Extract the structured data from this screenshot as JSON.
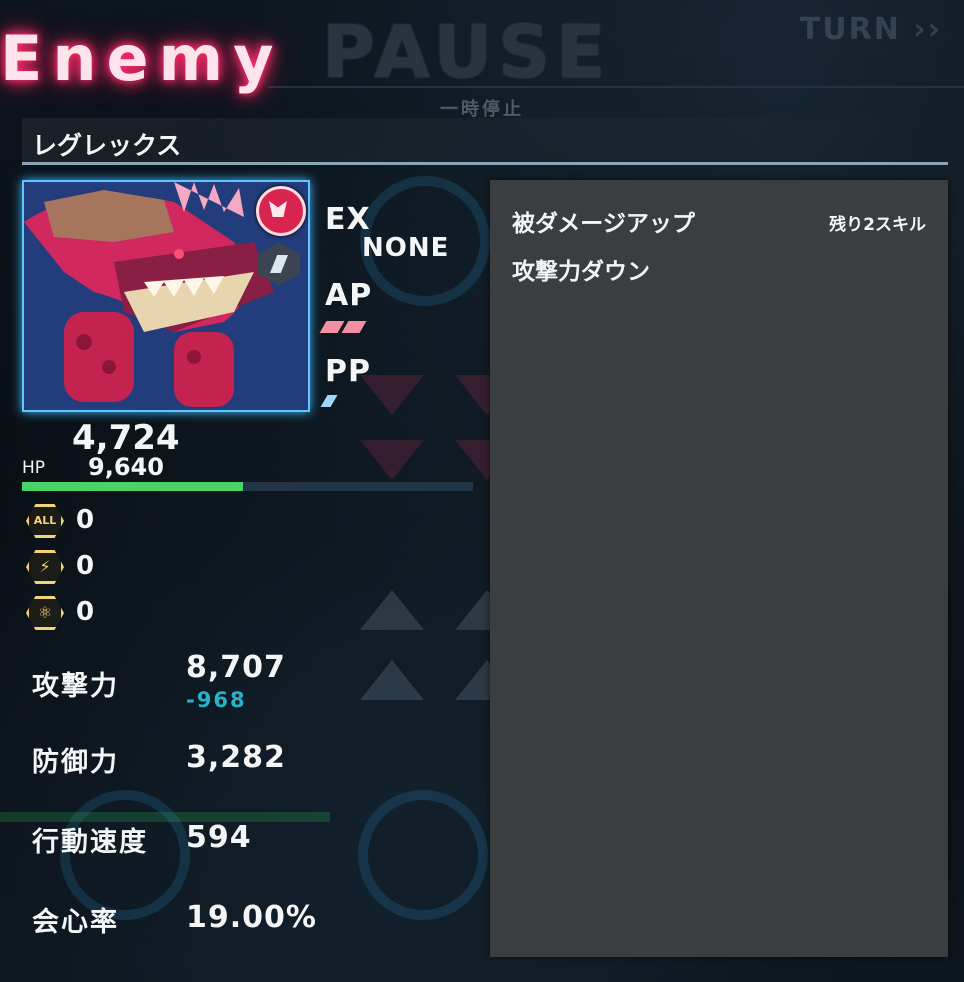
{
  "header": {
    "enemy_title": "Enemy",
    "pause_title": "PAUSE",
    "pause_sub": "一時停止",
    "turn_label": "TURN"
  },
  "enemy": {
    "name": "レグレックス",
    "ex_label": "EX",
    "ex_value": "NONE",
    "ap_label": "AP",
    "pp_label": "PP",
    "ap_pips": 2,
    "pp_pips": 1,
    "hp_current": "4,724",
    "hp_label": "HP",
    "hp_max": "9,640",
    "hp_fraction": 0.49,
    "resist": [
      {
        "icon": "all-resist-icon",
        "text": "ALL",
        "value": "0"
      },
      {
        "icon": "lightning-resist-icon",
        "text": "⚡",
        "value": "0"
      },
      {
        "icon": "atom-resist-icon",
        "text": "⚛",
        "value": "0"
      }
    ],
    "stats": {
      "attack_label": "攻撃力",
      "attack_value": "8,707",
      "attack_delta": "-968",
      "defense_label": "防御力",
      "defense_value": "3,282",
      "speed_label": "行動速度",
      "speed_value": "594",
      "crit_label": "会心率",
      "crit_value": "19.00%"
    }
  },
  "buffs": {
    "items": [
      "被ダメージアップ",
      "攻撃力ダウン"
    ],
    "note": "残り2スキル"
  },
  "colors": {
    "enemy_glow": "#ff2d6b",
    "hp_bar": "#49d46a",
    "portrait_border": "#5ec7ff",
    "panel_bg": "#3a3e40",
    "debuff_text": "#25b3c9"
  }
}
